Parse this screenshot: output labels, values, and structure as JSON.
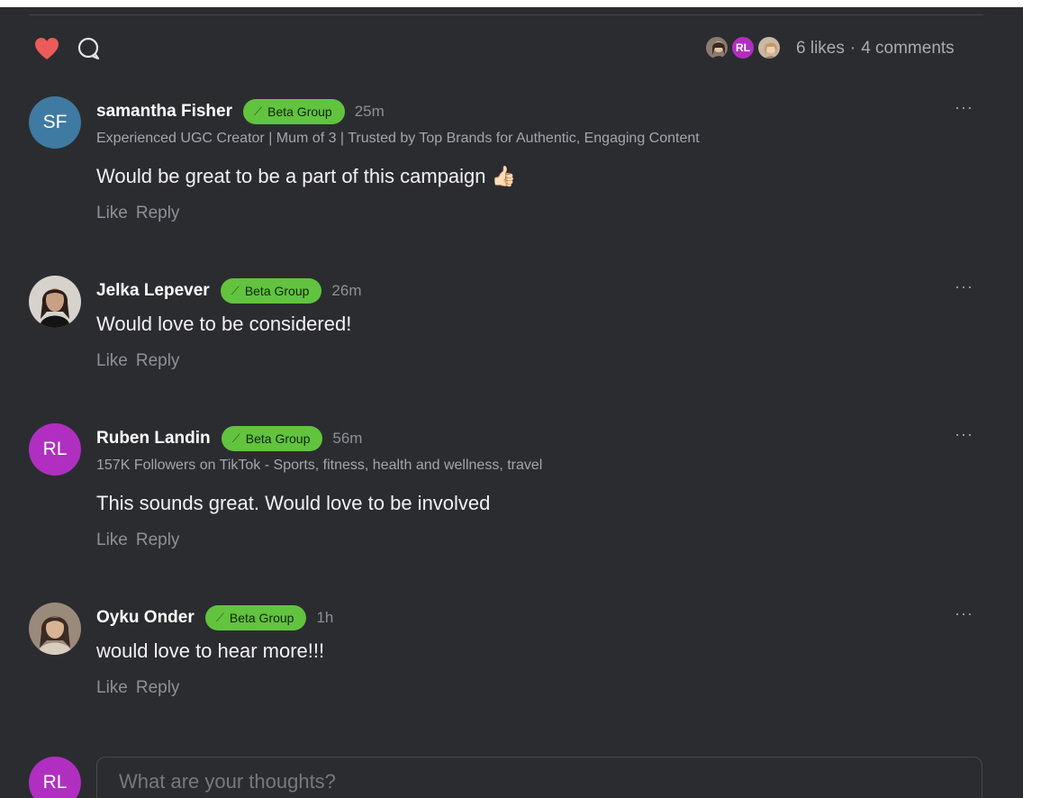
{
  "colors": {
    "background": "#2b2c30",
    "heart": "#ec5b5b",
    "badge": "#62c33f",
    "avatar_sf": "#3e7aa2",
    "avatar_rl": "#b02fc1"
  },
  "post_actions": {
    "like_icon": "heart-icon",
    "comment_icon": "comment-bubble-icon",
    "liker_avatar_initials": "RL",
    "likes_label": "6 likes",
    "separator": "·",
    "comments_label": "4 comments"
  },
  "comments": [
    {
      "avatar_initials": "SF",
      "author": "samantha Fisher",
      "badge": "Beta Group",
      "time": "25m",
      "bio": "Experienced UGC Creator | Mum of 3 | Trusted by Top Brands for Authentic, Engaging Content",
      "text": "Would be great to be a part of this campaign 👍🏻",
      "like_label": "Like",
      "reply_label": "Reply",
      "more_label": "···"
    },
    {
      "avatar_initials": "",
      "author": "Jelka Lepever",
      "badge": "Beta Group",
      "time": "26m",
      "bio": "",
      "text": "Would love to be considered!",
      "like_label": "Like",
      "reply_label": "Reply",
      "more_label": "···"
    },
    {
      "avatar_initials": "RL",
      "author": "Ruben Landin",
      "badge": "Beta Group",
      "time": "56m",
      "bio": "157K Followers on TikTok - Sports, fitness, health and wellness, travel",
      "text": "This sounds great. Would love to be involved",
      "like_label": "Like",
      "reply_label": "Reply",
      "more_label": "···"
    },
    {
      "avatar_initials": "",
      "author": "Oyku Onder",
      "badge": "Beta Group",
      "time": "1h",
      "bio": "",
      "text": "would love to hear more!!!",
      "like_label": "Like",
      "reply_label": "Reply",
      "more_label": "···"
    }
  ],
  "composer": {
    "avatar_initials": "RL",
    "placeholder": "What are your thoughts?"
  }
}
